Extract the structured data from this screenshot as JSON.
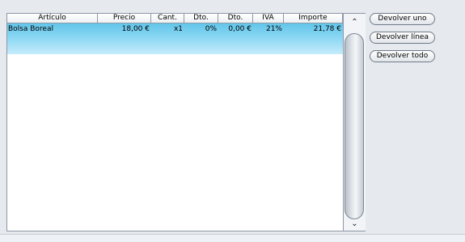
{
  "table": {
    "columns": [
      "Artículo",
      "Precio",
      "Cant.",
      "Dto.",
      "Dto.",
      "IVA",
      "Importe"
    ],
    "rows": [
      {
        "articulo": "Bolsa Boreal",
        "precio": "18,00 €",
        "cantidad": "x1",
        "dto_pct": "0%",
        "dto_importe": "0,00 €",
        "iva": "21%",
        "importe": "21,78 €"
      }
    ]
  },
  "scrollbar": {
    "up_glyph": "⌃",
    "down_glyph": "⌄"
  },
  "actions": {
    "devolver_uno": "Devolver uno",
    "devolver_linea": "Devolver línea",
    "devolver_todo": "Devolver todo"
  },
  "colors": {
    "selected_row": "#8ad6f3",
    "border": "#8e98a6"
  }
}
